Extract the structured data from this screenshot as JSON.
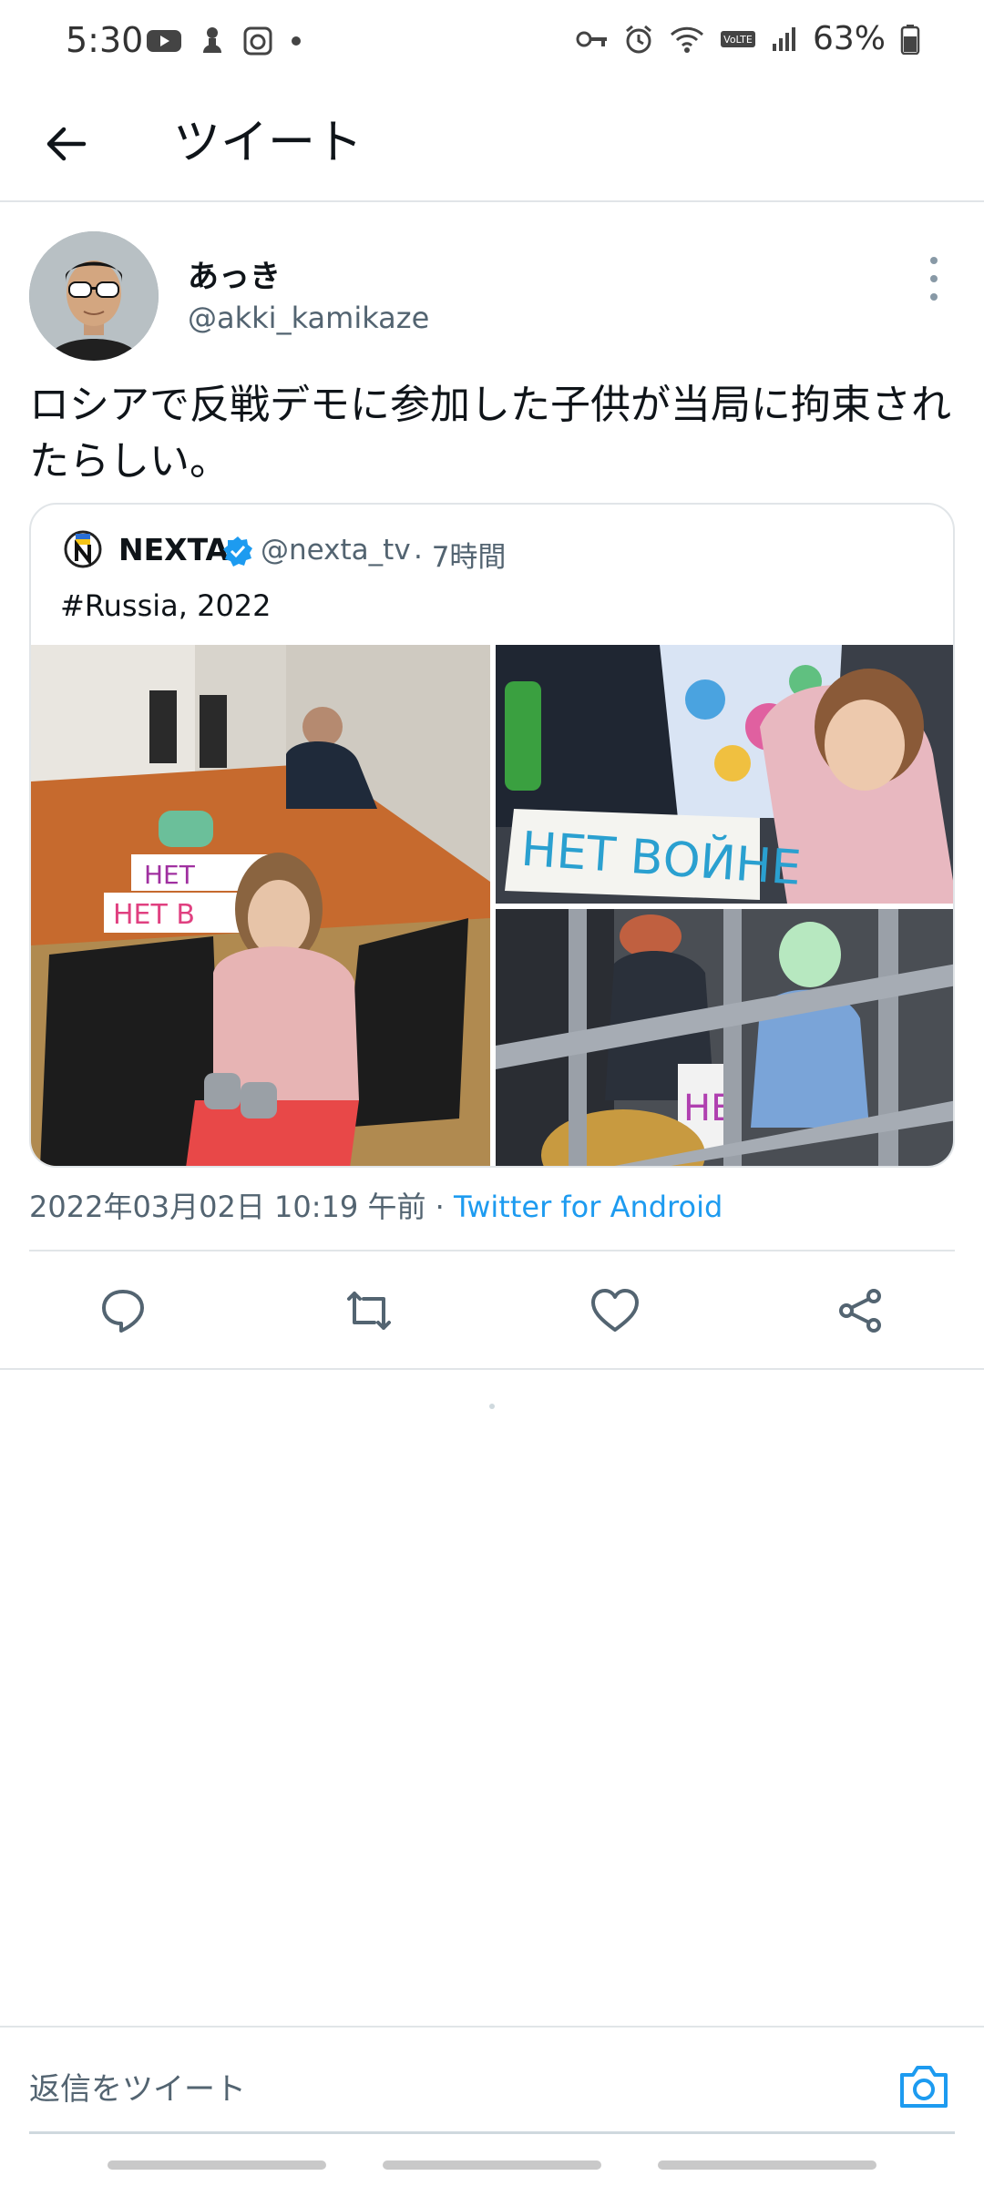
{
  "status_bar": {
    "time": "5:30",
    "battery": "63%",
    "left_icons": [
      "youtube-icon",
      "notification-icon",
      "camera-app-icon",
      "dot-icon"
    ],
    "right_icons": [
      "key-icon",
      "alarm-icon",
      "wifi-icon",
      "volte-icon",
      "signal-icon",
      "battery-icon"
    ]
  },
  "header": {
    "title": "ツイート"
  },
  "tweet": {
    "author_name": "あっき",
    "author_handle": "@akki_kamikaze",
    "text": "ロシアで反戦デモに参加した子供が当局に拘束されたらしい。",
    "timestamp": "2022年03月02日 10:19 午前",
    "separator": " · ",
    "source": "Twitter for Android"
  },
  "quoted_tweet": {
    "name": "NEXTA",
    "handle": "@nexta_tv",
    "time": " · 7時間",
    "text": "#Russia, 2022",
    "photo_signs": {
      "sign1": "НЕТ",
      "sign2": "НЕТ В",
      "sign3": "НЕТ ВОЙНЕ",
      "sign4": "НЕ"
    }
  },
  "actions": [
    "reply-icon",
    "retweet-icon",
    "like-icon",
    "share-icon"
  ],
  "reply_bar": {
    "placeholder": "返信をツイート"
  },
  "colors": {
    "accent": "#1d9bf0",
    "secondary_text": "#536471",
    "divider": "#e1e5e8"
  }
}
